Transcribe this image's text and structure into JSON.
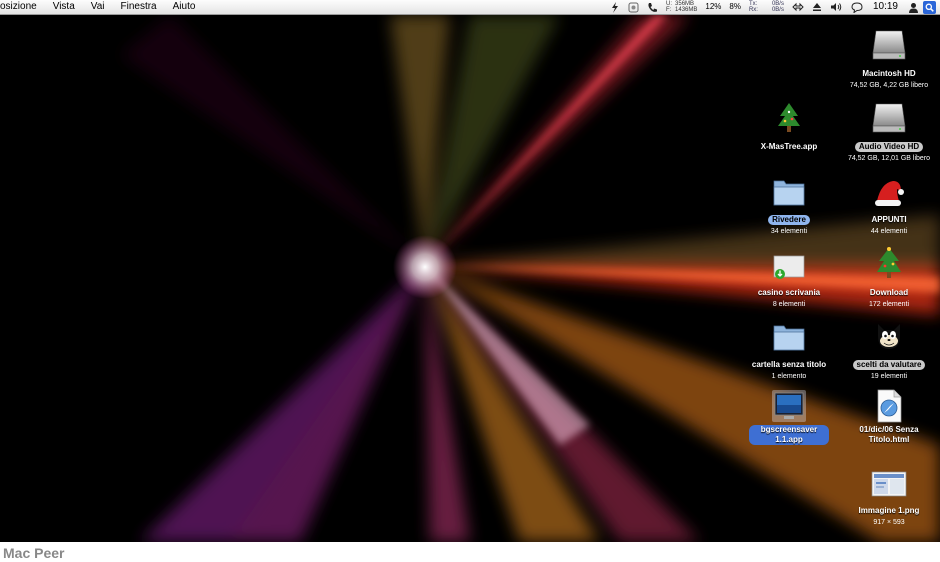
{
  "menubar": {
    "menus": [
      "osizione",
      "Vista",
      "Vai",
      "Finestra",
      "Aiuto"
    ],
    "mem_top": "356MB",
    "mem_bottom": "1436MB",
    "mem_labels": [
      "U:",
      "F:"
    ],
    "cpu1": "12%",
    "cpu2": "8%",
    "net_tx_label": "Tx:",
    "net_rx_label": "Rx:",
    "net_tx": "0B/s",
    "net_rx": "0B/s",
    "clock": "10:19"
  },
  "icons": [
    {
      "name": "Macintosh HD",
      "sub": "74,52 GB, 4,22 GB libero",
      "icon": "hard-drive-icon",
      "style": ""
    },
    {
      "name": "X-MasTree.app",
      "sub": "",
      "icon": "xmas-tree-icon",
      "style": ""
    },
    {
      "name": "Audio Video HD",
      "sub": "74,52 GB, 12,01 GB libero",
      "icon": "hard-drive-icon",
      "style": "selgray"
    },
    {
      "name": "Rivedere",
      "sub": "34 elementi",
      "icon": "folder-icon",
      "style": "sellight"
    },
    {
      "name": "APPUNTI",
      "sub": "44 elementi",
      "icon": "santa-hat-icon",
      "style": ""
    },
    {
      "name": "casino scrivania",
      "sub": "8 elementi",
      "icon": "download-folder-icon",
      "style": ""
    },
    {
      "name": "Download",
      "sub": "172 elementi",
      "icon": "xmas-tree-icon",
      "style": ""
    },
    {
      "name": "cartella senza titolo",
      "sub": "1 elemento",
      "icon": "folder-icon",
      "style": ""
    },
    {
      "name": "scelti da valutare",
      "sub": "19 elementi",
      "icon": "felix-cat-icon",
      "style": "selgray"
    },
    {
      "name": "bgscreensaver 1.1.app",
      "sub": "",
      "icon": "monitor-app-icon",
      "style": "sel"
    },
    {
      "name": "01/dic/06 Senza Titolo.html",
      "sub": "",
      "icon": "html-document-icon",
      "style": ""
    },
    {
      "name": "Immagine 1.png",
      "sub": "917 × 593",
      "icon": "png-image-icon",
      "style": ""
    }
  ],
  "footer": {
    "brand": "Mac Peer"
  }
}
